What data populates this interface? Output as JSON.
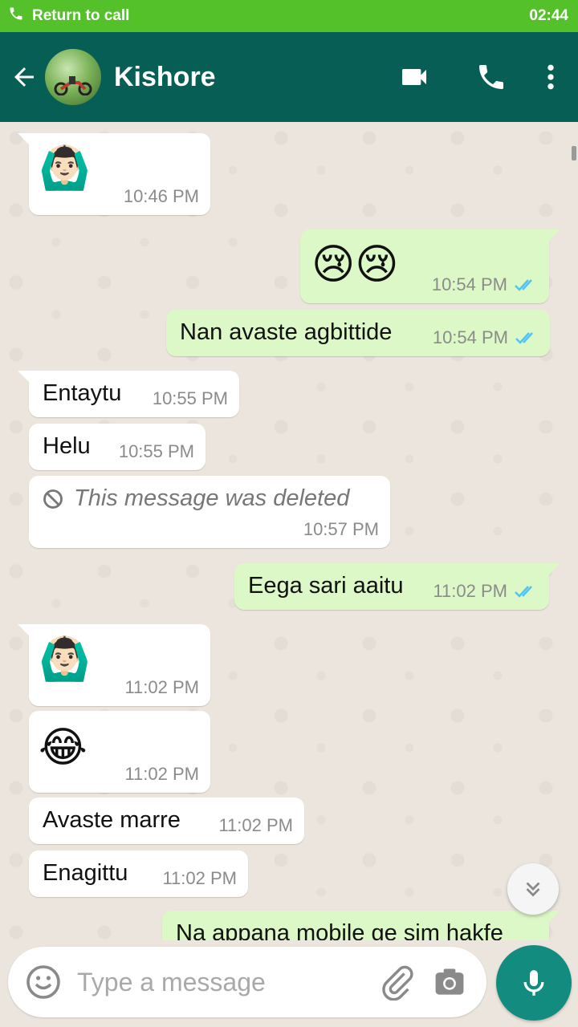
{
  "call_banner": {
    "label": "Return to call",
    "time": "02:44"
  },
  "header": {
    "contact_name": "Kishore"
  },
  "messages": [
    {
      "dir": "in",
      "type": "emoji",
      "content": "🙆🏻‍♂️",
      "time": "10:46 PM"
    },
    {
      "dir": "out",
      "type": "emoji",
      "content": "😢😢",
      "time": "10:54 PM",
      "status": "read"
    },
    {
      "dir": "out",
      "type": "text",
      "content": "Nan avaste agbittide",
      "time": "10:54 PM",
      "status": "read"
    },
    {
      "dir": "in",
      "type": "text",
      "content": "Entaytu",
      "time": "10:55 PM"
    },
    {
      "dir": "in",
      "type": "text",
      "content": "Helu",
      "time": "10:55 PM"
    },
    {
      "dir": "in",
      "type": "deleted",
      "content": "This message was deleted",
      "time": "10:57 PM"
    },
    {
      "dir": "out",
      "type": "text",
      "content": "Eega sari aaitu",
      "time": "11:02 PM",
      "status": "read"
    },
    {
      "dir": "in",
      "type": "emoji",
      "content": "🙆🏻‍♂️",
      "time": "11:02 PM"
    },
    {
      "dir": "in",
      "type": "emoji",
      "content": "😂",
      "time": "11:02 PM"
    },
    {
      "dir": "in",
      "type": "text",
      "content": "Avaste marre",
      "time": "11:02 PM"
    },
    {
      "dir": "in",
      "type": "text",
      "content": "Enagittu",
      "time": "11:02 PM"
    },
    {
      "dir": "out",
      "type": "text",
      "content": "Na appana mobile ge sim hakfe",
      "time": "",
      "status": ""
    }
  ],
  "input": {
    "placeholder": "Type a message"
  },
  "icons": {
    "call_banner": "phone-icon",
    "back": "arrow-left-icon",
    "video": "video-camera-icon",
    "call": "phone-icon",
    "more": "more-vertical-icon",
    "emoji": "smiley-icon",
    "attach": "paperclip-icon",
    "camera": "camera-icon",
    "mic": "microphone-icon",
    "scroll_down": "chevron-double-down-icon",
    "deleted": "block-icon",
    "read_ticks": "double-check-icon"
  },
  "colors": {
    "banner": "#55c12a",
    "header": "#075e54",
    "outgoing_bubble": "#dcf8c6",
    "incoming_bubble": "#ffffff",
    "read_ticks": "#4fc3f7",
    "mic_button": "#128c7e",
    "chat_background": "#ece5dd"
  }
}
